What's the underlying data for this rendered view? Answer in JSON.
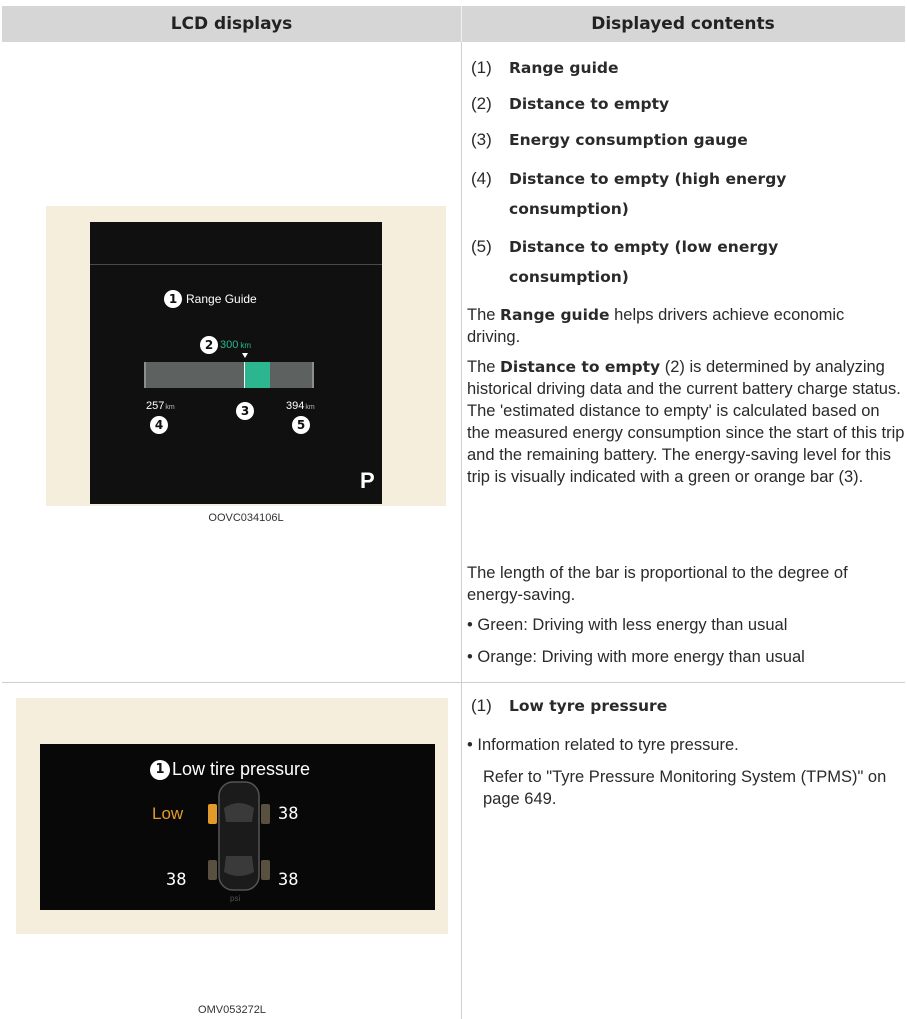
{
  "table": {
    "header_left": "LCD displays",
    "header_right": "Displayed contents"
  },
  "row1": {
    "items": [
      {
        "num": "(1)",
        "label": "Range guide"
      },
      {
        "num": "(2)",
        "label": "Distance to empty"
      },
      {
        "num": "(3)",
        "label": "Energy consumption gauge"
      },
      {
        "num": "(4)",
        "label": "Distance to empty (high energy",
        "cont": "consumption)"
      },
      {
        "num": "(5)",
        "label": "Distance to empty (low energy",
        "cont": "consumption)"
      }
    ],
    "para1": {
      "pre": "The ",
      "bold": "Range guide",
      "post": " helps drivers achieve economic driving."
    },
    "para2": {
      "pre": "The ",
      "bold": "Distance to empty",
      "post": " (2) is determined by analyzing historical driving data and the current battery charge status. The 'estimated distance to empty' is calculated based on the measured energy consumption since the start of this trip and the remaining battery. The energy-saving level for this trip is visually indicated with a green or orange bar (3)."
    },
    "para3": "The length of the bar is proportional to the degree of energy-saving.",
    "bullets": [
      "Green: Driving with less energy than usual",
      "Orange: Driving with more energy than usual"
    ],
    "image": {
      "badge1": "1",
      "title": "Range Guide",
      "badge2": "2",
      "center_value": "300",
      "center_unit": "km",
      "badge3": "3",
      "left_value": "257",
      "left_unit": "km",
      "badge4": "4",
      "right_value": "394",
      "right_unit": "km",
      "badge5": "5",
      "gear": "P",
      "caption": "OOVC034106L"
    }
  },
  "row2": {
    "item": {
      "num": "(1)",
      "label": "Low tyre pressure"
    },
    "bullet": "Information related to tyre pressure.",
    "ref": {
      "pre": "Refer to \"Tyre Pressure Monitoring System (TPMS)\"",
      "post": " on page 649."
    },
    "image": {
      "badge1": "1",
      "title": "Low tire pressure",
      "low_label": "Low",
      "fr_value": "38",
      "rl_value": "38",
      "rr_value": "38",
      "unit": "psi",
      "caption": "OMV053272L"
    }
  },
  "colors": {
    "header_bg": "#d6d6d6",
    "green": "#2bb68f",
    "orange": "#e29a2a",
    "image_bg": "#f5eedd"
  }
}
